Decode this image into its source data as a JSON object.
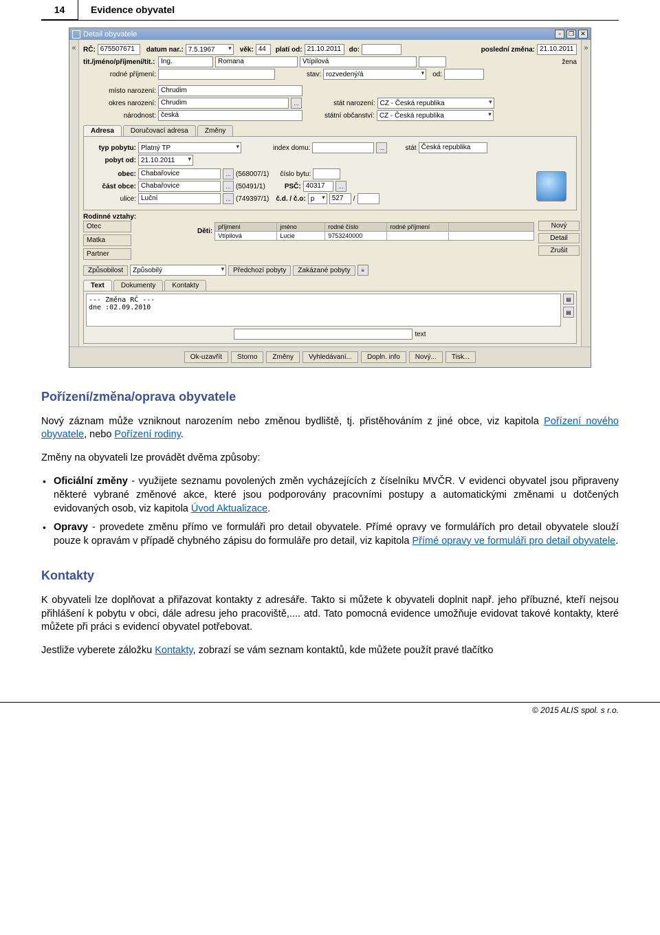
{
  "page": {
    "number": "14",
    "header_title": "Evidence obyvatel"
  },
  "window": {
    "title": "Detail obyvatele",
    "rc_label": "RČ:",
    "rc": "675507671",
    "dn_label": "datum nar.:",
    "dn": "7.5.1967",
    "vek_label": "věk:",
    "vek": "44",
    "platiod_label": "platí od:",
    "platiod": "21.10.2011",
    "do_label": "do:",
    "do_val": "",
    "posledni_label": "poslední změna:",
    "posledni": "21.10.2011",
    "tit_label": "tit./jméno/příjmení/tit.:",
    "tit1": "Ing.",
    "jmeno": "Romana",
    "prijmeni": "Vtípilová",
    "pohlavi": "žena",
    "rodne_label": "rodné příjmení:",
    "rodne": "",
    "stav_label": "stav:",
    "stav": "rozvedený/á",
    "stav_od_label": "od:",
    "mnaroz_label": "místo narození:",
    "mnaroz": "Chrudim",
    "onaroz_label": "okres narození:",
    "onaroz": "Chrudim",
    "statnaroz_label": "stát narození:",
    "statnaroz": "CZ - Česká republika",
    "narodnost_label": "národnost:",
    "narodnost": "česká",
    "obcanstvi_label": "státní občanství:",
    "obcanstvi": "CZ - Česká republika",
    "tabs": {
      "t1": "Adresa",
      "t2": "Doručovací adresa",
      "t3": "Změny"
    },
    "adr": {
      "typ_label": "typ pobytu:",
      "typ": "Platný TP",
      "index_label": "index domu:",
      "stat_label": "stát",
      "stat": "Česká republika",
      "pobytod_label": "pobyt od:",
      "pobytod": "21.10.2011",
      "obec_label": "obec:",
      "obec": "Chabařovice",
      "obec_code": "(568007/1)",
      "cislobytu_label": "číslo bytu:",
      "castobce_label": "část obce:",
      "castobce": "Chabařovice",
      "castobce_code": "(50491/1)",
      "psc_label": "PSČ:",
      "psc": "40317",
      "ulice_label": "ulice:",
      "ulice": "Luční",
      "ulice_code": "(749397/1)",
      "cdco_label": "č.d. / č.o:",
      "cd_type": "p",
      "cd": "527",
      "slash": "/"
    },
    "rodinne_label": "Rodinné vztahy:",
    "rel": {
      "otec": "Otec",
      "matka": "Matka",
      "partner": "Partner"
    },
    "deti_label": "Děti:",
    "kids_header": {
      "c1": "příjmení",
      "c2": "jméno",
      "c3": "rodné číslo",
      "c4": "rodné příjmení"
    },
    "kids_row": {
      "c1": "Vtípilová",
      "c2": "Lucie",
      "c3": "9753240000",
      "c4": ""
    },
    "kids_btn": {
      "novy": "Nový",
      "detail": "Detail",
      "zrusit": "Zrušit"
    },
    "zpusob_label": "Způsobilost",
    "zpusob": "Způsobilý",
    "predchozi": "Předchozí pobyty",
    "zakazane": "Zakázané pobyty",
    "subtabs": {
      "t1": "Text",
      "t2": "Dokumenty",
      "t3": "Kontakty"
    },
    "textarea": "--- Změna RČ ---\ndne :02.09.2010",
    "text_input_label": "text",
    "footer": {
      "ok": "Ok-uzavřít",
      "storno": "Storno",
      "zmeny": "Změny",
      "vyhled": "Vyhledávaní...",
      "dopln": "Dopln. info",
      "novy": "Nový...",
      "tisk": "Tisk..."
    }
  },
  "doc": {
    "h1": "Pořízení/změna/oprava obyvatele",
    "p1a": "Nový záznam může vzniknout narozením nebo změnou bydliště, tj. přistěhováním z jiné obce, viz kapitola ",
    "p1_link1": "Pořízení nového obyvatele",
    "p1b": ", nebo ",
    "p1_link2": "Pořízení rodiny",
    "p1c": ".",
    "p2": "Změny na obyvateli lze provádět dvěma způsoby:",
    "b1_strong": "Oficiální změny",
    "b1_rest": " - využijete seznamu povolených změn vycházejících z číselníku MVČR. V evidenci obyvatel jsou připraveny některé vybrané změnové akce, které jsou podporovány pracovními postupy a automatickými změnami u dotčených evidovaných osob, viz kapitola ",
    "b1_link": "Úvod Aktualizace",
    "b1_end": ".",
    "b2_strong": "Opravy",
    "b2_rest": " - provedete změnu přímo ve formuláři pro detail obyvatele. Přímé opravy ve formulářích pro detail obyvatele slouží pouze k opravám v případě chybného zápisu do formuláře pro detail, viz kapitola ",
    "b2_link": "Přímé opravy ve formuláři pro detail obyvatele",
    "b2_end": ".",
    "h2": "Kontakty",
    "p3": "K obyvateli lze doplňovat a přiřazovat kontakty z adresáře. Takto si můžete k obyvateli doplnit např. jeho příbuzné, kteří nejsou přihlášení k pobytu v obci, dále adresu jeho pracoviště,.... atd. Tato pomocná evidence umožňuje evidovat takové kontakty, které můžete při práci s evidencí obyvatel potřebovat.",
    "p4a": "Jestliže vyberete záložku ",
    "p4_link": "Kontakty",
    "p4b": ", zobrazí se vám seznam kontaktů, kde můžete použít pravé tlačítko",
    "copyright": "© 2015 ALIS spol. s r.o."
  }
}
